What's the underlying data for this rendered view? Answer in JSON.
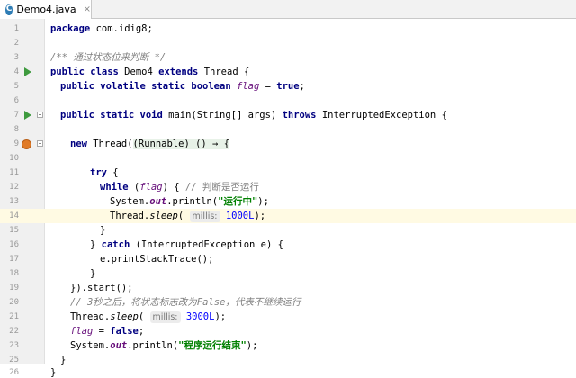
{
  "tab": {
    "filename": "Demo4.java",
    "icon": "c-class-icon",
    "icon_letter": "C",
    "close": "×"
  },
  "colors": {
    "keyword": "#000080",
    "comment": "#808080",
    "string": "#008000",
    "static_field": "#660e7a",
    "number": "#0000ff",
    "current_line": "#fffae3",
    "run": "#3e9a3e"
  },
  "lines": [
    {
      "n": "1"
    },
    {
      "n": "2"
    },
    {
      "n": "3"
    },
    {
      "n": "4"
    },
    {
      "n": "5"
    },
    {
      "n": "6"
    },
    {
      "n": "7"
    },
    {
      "n": "8"
    },
    {
      "n": "9"
    },
    {
      "n": "10"
    },
    {
      "n": "11"
    },
    {
      "n": "12"
    },
    {
      "n": "13"
    },
    {
      "n": "14"
    },
    {
      "n": "15"
    },
    {
      "n": "16"
    },
    {
      "n": "17"
    },
    {
      "n": "18"
    },
    {
      "n": "19"
    },
    {
      "n": "20"
    },
    {
      "n": "21"
    },
    {
      "n": "22"
    },
    {
      "n": "23"
    },
    {
      "n": "24"
    },
    {
      "n": "25"
    },
    {
      "n": "26"
    }
  ],
  "code": {
    "l1": {
      "kw": "package",
      "rest": " com.idig8;"
    },
    "l3": {
      "comment": "/** 通过状态位来判断 */"
    },
    "l4": {
      "kw1": "public class",
      "name": " Demo4 ",
      "kw2": "extends",
      "rest": " Thread {"
    },
    "l5": {
      "kw": "public volatile static boolean",
      "field": "flag",
      "eq": " = ",
      "val": "true",
      "end": ";"
    },
    "l7": {
      "kw": "public static void",
      "mid": " main(String[] args) ",
      "kw2": "throws",
      "rest": " InterruptedException {"
    },
    "l9": {
      "kw": "new",
      "mid": " Thread(",
      "lambda": "(Runnable) () → {"
    },
    "l11": {
      "kw": "try",
      "rest": " {"
    },
    "l12": {
      "kw": "while",
      "open": " (",
      "field": "flag",
      "close": ") { ",
      "comment": "// 判断是否运行"
    },
    "l13": {
      "pre": "System.",
      "field": "out",
      "mid": ".println(",
      "str": "\"运行中\"",
      "end": ");"
    },
    "l14": {
      "pre": "Thread.",
      "method": "sleep",
      "open": "( ",
      "hint": "millis:",
      "num": "1000L",
      "end": ");"
    },
    "l15": {
      "text": "}"
    },
    "l16": {
      "pre": "} ",
      "kw": "catch",
      "rest": " (InterruptedException e) {"
    },
    "l17": {
      "text": "e.printStackTrace();"
    },
    "l18": {
      "text": "}"
    },
    "l19": {
      "text": "}).start();"
    },
    "l20": {
      "comment": "// 3秒之后，将状态标志改为False，代表不继续运行"
    },
    "l21": {
      "pre": "Thread.",
      "method": "sleep",
      "open": "( ",
      "hint": "millis:",
      "num": "3000L",
      "end": ");"
    },
    "l22": {
      "field": "flag",
      "eq": " = ",
      "val": "false",
      "end": ";"
    },
    "l23": {
      "pre": "System.",
      "field": "out",
      "mid": ".println(",
      "str": "\"程序运行结束\"",
      "end": ");"
    },
    "l25": {
      "text": "}"
    },
    "l26": {
      "text": "}"
    }
  }
}
